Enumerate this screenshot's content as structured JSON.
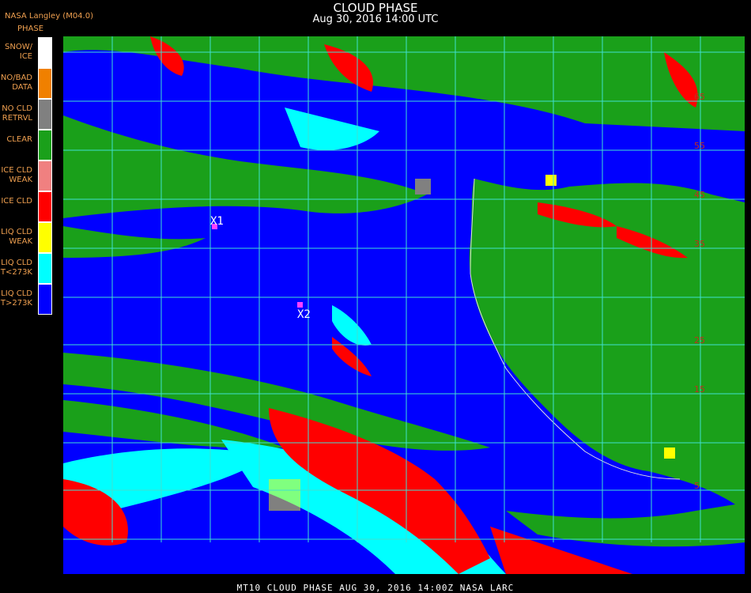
{
  "header": {
    "title": "CLOUD PHASE",
    "subtitle": "Aug 30, 2016 14:00 UTC",
    "org": "NASA Langley (M04.0)",
    "legend_title": "PHASE"
  },
  "legend": [
    {
      "label": "SNOW/\nICE",
      "color": "#ffffff"
    },
    {
      "label": "NO/BAD\nDATA",
      "color": "#f08000"
    },
    {
      "label": "NO CLD\nRETRVL",
      "color": "#808080"
    },
    {
      "label": "CLEAR",
      "color": "#1aa01a"
    },
    {
      "label": "ICE CLD\nWEAK",
      "color": "#f08080"
    },
    {
      "label": "ICE CLD",
      "color": "#ff0000"
    },
    {
      "label": "LIQ CLD\nWEAK",
      "color": "#ffff00"
    },
    {
      "label": "LIQ CLD\nT<273K",
      "color": "#00ffff"
    },
    {
      "label": "LIQ CLD\nT>273K",
      "color": "#0000ff"
    }
  ],
  "markers": [
    {
      "label": "X1",
      "color": "#ff40ff"
    },
    {
      "label": "X2",
      "color": "#ff40ff"
    }
  ],
  "grid_labels": [
    "65",
    "55",
    "45",
    "35",
    "25",
    "15",
    "5"
  ],
  "footer": "MT10  CLOUD PHASE   AUG 30, 2016 14:00Z   NASA LARC"
}
